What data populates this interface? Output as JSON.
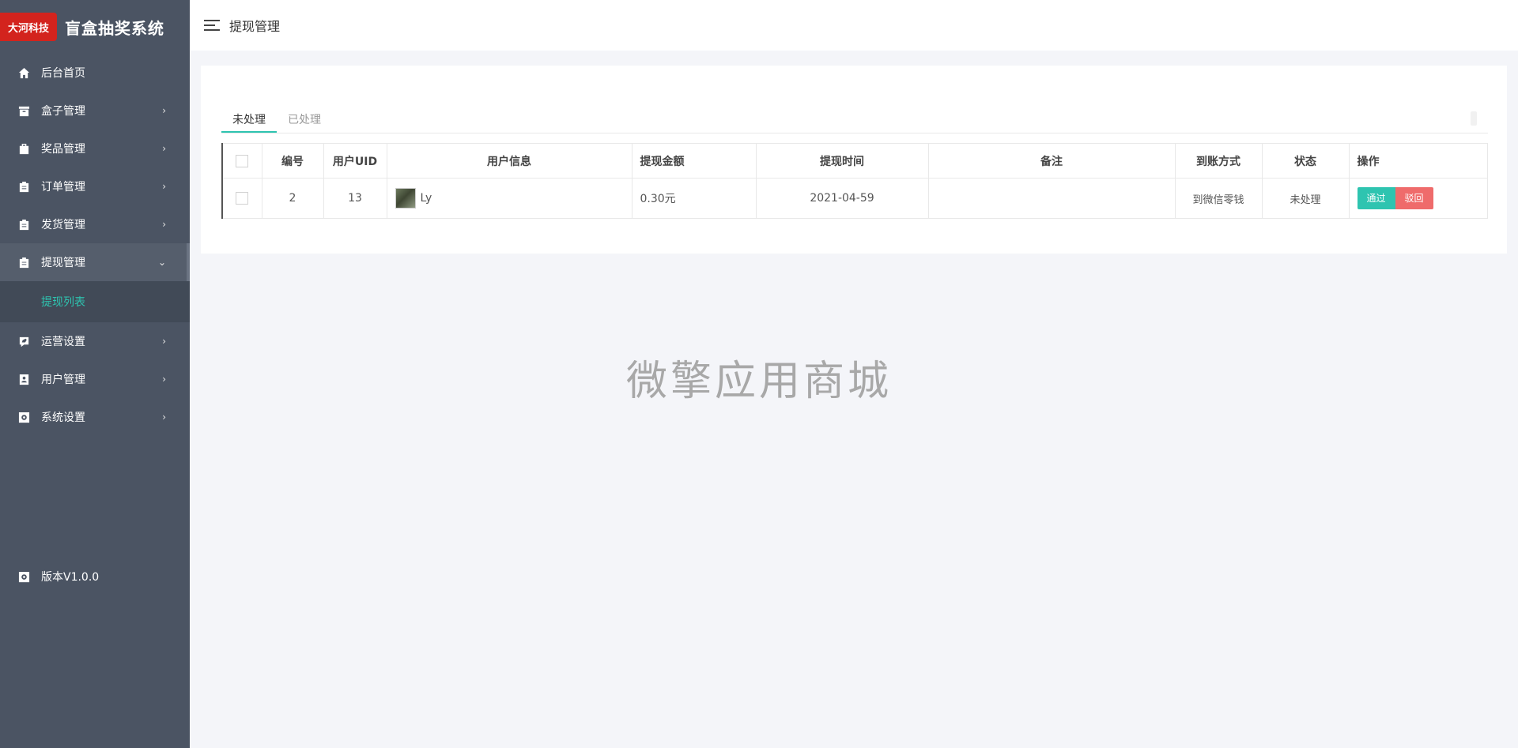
{
  "brand": {
    "logo_text": "大河科技",
    "title": "盲盒抽奖系统"
  },
  "menu": [
    {
      "label": "后台首页",
      "icon": "home-icon",
      "arrow": ""
    },
    {
      "label": "盒子管理",
      "icon": "box-icon",
      "arrow": "›"
    },
    {
      "label": "奖品管理",
      "icon": "prize-icon",
      "arrow": "›"
    },
    {
      "label": "订单管理",
      "icon": "clipboard-icon",
      "arrow": "›"
    },
    {
      "label": "发货管理",
      "icon": "clipboard-icon",
      "arrow": "›"
    },
    {
      "label": "提现管理",
      "icon": "clipboard-icon",
      "arrow": "⌄"
    },
    {
      "label": "运营设置",
      "icon": "settings-edit-icon",
      "arrow": "›"
    },
    {
      "label": "用户管理",
      "icon": "user-card-icon",
      "arrow": "›"
    },
    {
      "label": "系统设置",
      "icon": "gear-icon",
      "arrow": "›"
    }
  ],
  "submenu": {
    "label": "提现列表"
  },
  "version": {
    "label": "版本V1.0.0"
  },
  "header": {
    "title": "提现管理"
  },
  "tabs": [
    {
      "label": "未处理"
    },
    {
      "label": "已处理"
    }
  ],
  "table": {
    "headers": [
      "编号",
      "用户UID",
      "用户信息",
      "提现金额",
      "提现时间",
      "备注",
      "到账方式",
      "状态",
      "操作"
    ],
    "rows": [
      {
        "id": "2",
        "uid": "13",
        "user": "Ly",
        "amount": "0.30元",
        "time": "2021-04-59",
        "remark": "",
        "method": "到微信零钱",
        "status": "未处理"
      }
    ],
    "actions": {
      "pass": "通过",
      "reject": "驳回"
    }
  },
  "watermark": "微擎应用商城",
  "colors": {
    "sidebar": "#4b5463",
    "accent": "#2ec4b0",
    "danger": "#ef6b6b",
    "brand": "#d3231d"
  }
}
